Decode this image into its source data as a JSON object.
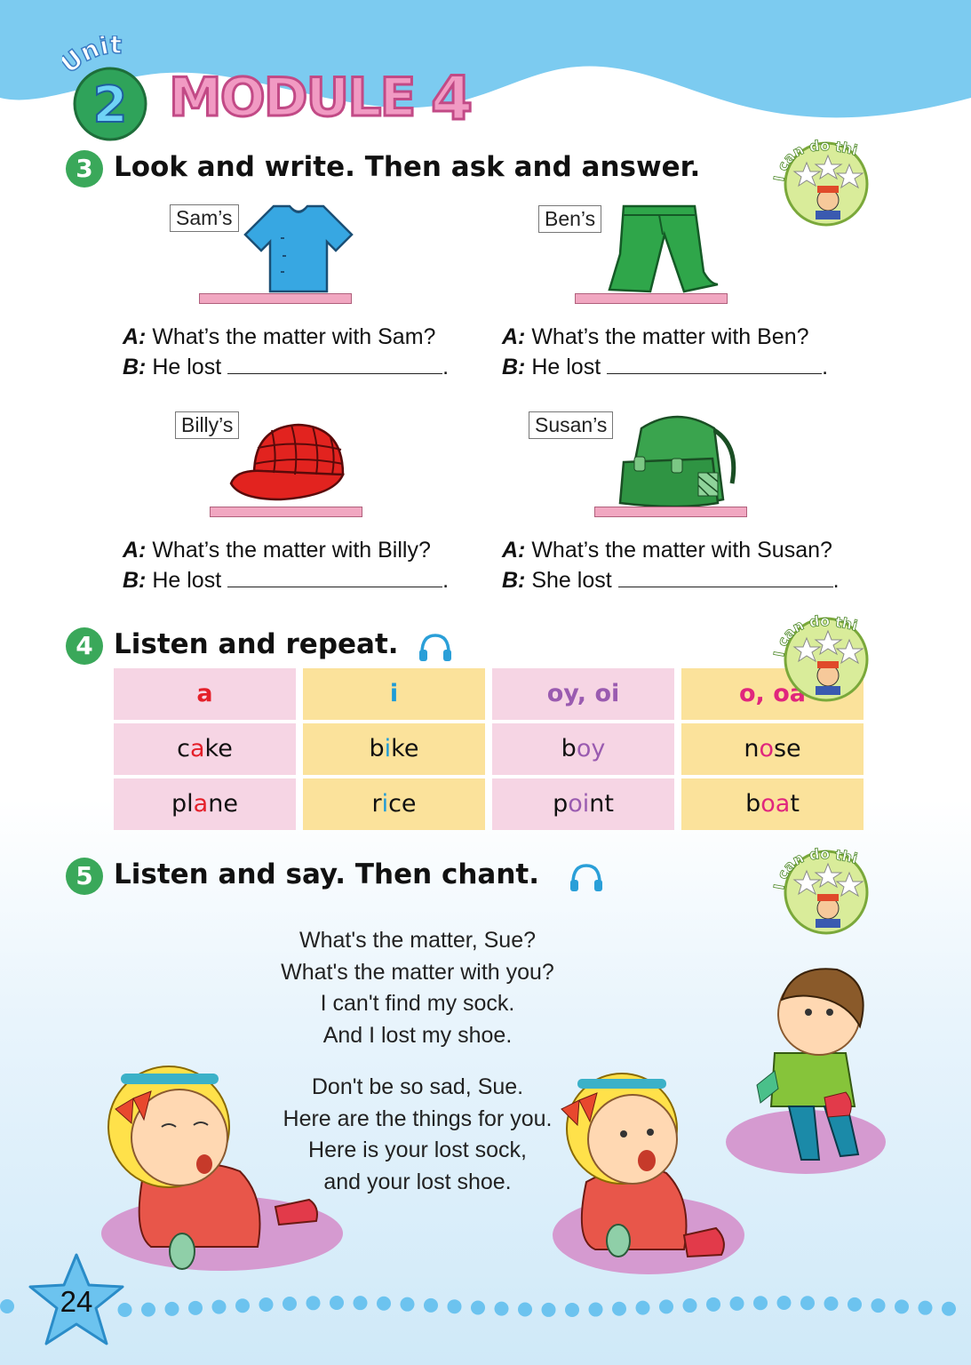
{
  "header": {
    "unit_word": "Unit",
    "unit_number": "2",
    "module_word": "MODULE",
    "module_number": "4"
  },
  "badge_text": "I can do this.",
  "section3": {
    "number": "3",
    "title": "Look and write. Then ask and answer.",
    "items": [
      {
        "tag": "Sam’s",
        "a_label": "A:",
        "a_text": " What’s the matter with Sam?",
        "b_label": "B:",
        "b_text": " He lost "
      },
      {
        "tag": "Ben’s",
        "a_label": "A:",
        "a_text": " What’s the matter with Ben?",
        "b_label": "B:",
        "b_text": " He lost "
      },
      {
        "tag": "Billy’s",
        "a_label": "A:",
        "a_text": " What’s the matter with Billy?",
        "b_label": "B:",
        "b_text": " He lost "
      },
      {
        "tag": "Susan’s",
        "a_label": "A:",
        "a_text": " What’s the matter with Susan?",
        "b_label": "B:",
        "b_text": " She lost "
      }
    ],
    "end_punct": "."
  },
  "section4": {
    "number": "4",
    "title": "Listen and repeat.",
    "icon": "headphones-icon",
    "columns": [
      {
        "header": "a",
        "color": "#e4202a",
        "words": [
          [
            "c",
            "a",
            "ke"
          ],
          [
            "pl",
            "a",
            "ne"
          ]
        ]
      },
      {
        "header": "i",
        "color": "#1e9bd7",
        "words": [
          [
            "b",
            "i",
            "ke"
          ],
          [
            "r",
            "i",
            "ce"
          ]
        ]
      },
      {
        "header": "oy, oi",
        "color": "#9a5bb0",
        "words": [
          [
            "b",
            "oy",
            ""
          ],
          [
            "p",
            "oi",
            "nt"
          ]
        ]
      },
      {
        "header": "o, oa",
        "color": "#e0267d",
        "words": [
          [
            "n",
            "o",
            "se"
          ],
          [
            "b",
            "oa",
            "t"
          ]
        ]
      }
    ]
  },
  "section5": {
    "number": "5",
    "title": "Listen and say. Then chant.",
    "icon": "headphones-icon",
    "verse1": [
      "What's the matter, Sue?",
      "What's the matter with you?",
      "I can't find my sock.",
      "And I lost my shoe."
    ],
    "verse2": [
      "Don't be so sad, Sue.",
      "Here are the things for you.",
      "Here is your lost sock,",
      "and your lost shoe."
    ]
  },
  "page_number": "24",
  "colors": {
    "sky": "#7ccbf0",
    "section_green": "#3aa85a",
    "shelf_pink": "#f1a7c1"
  }
}
